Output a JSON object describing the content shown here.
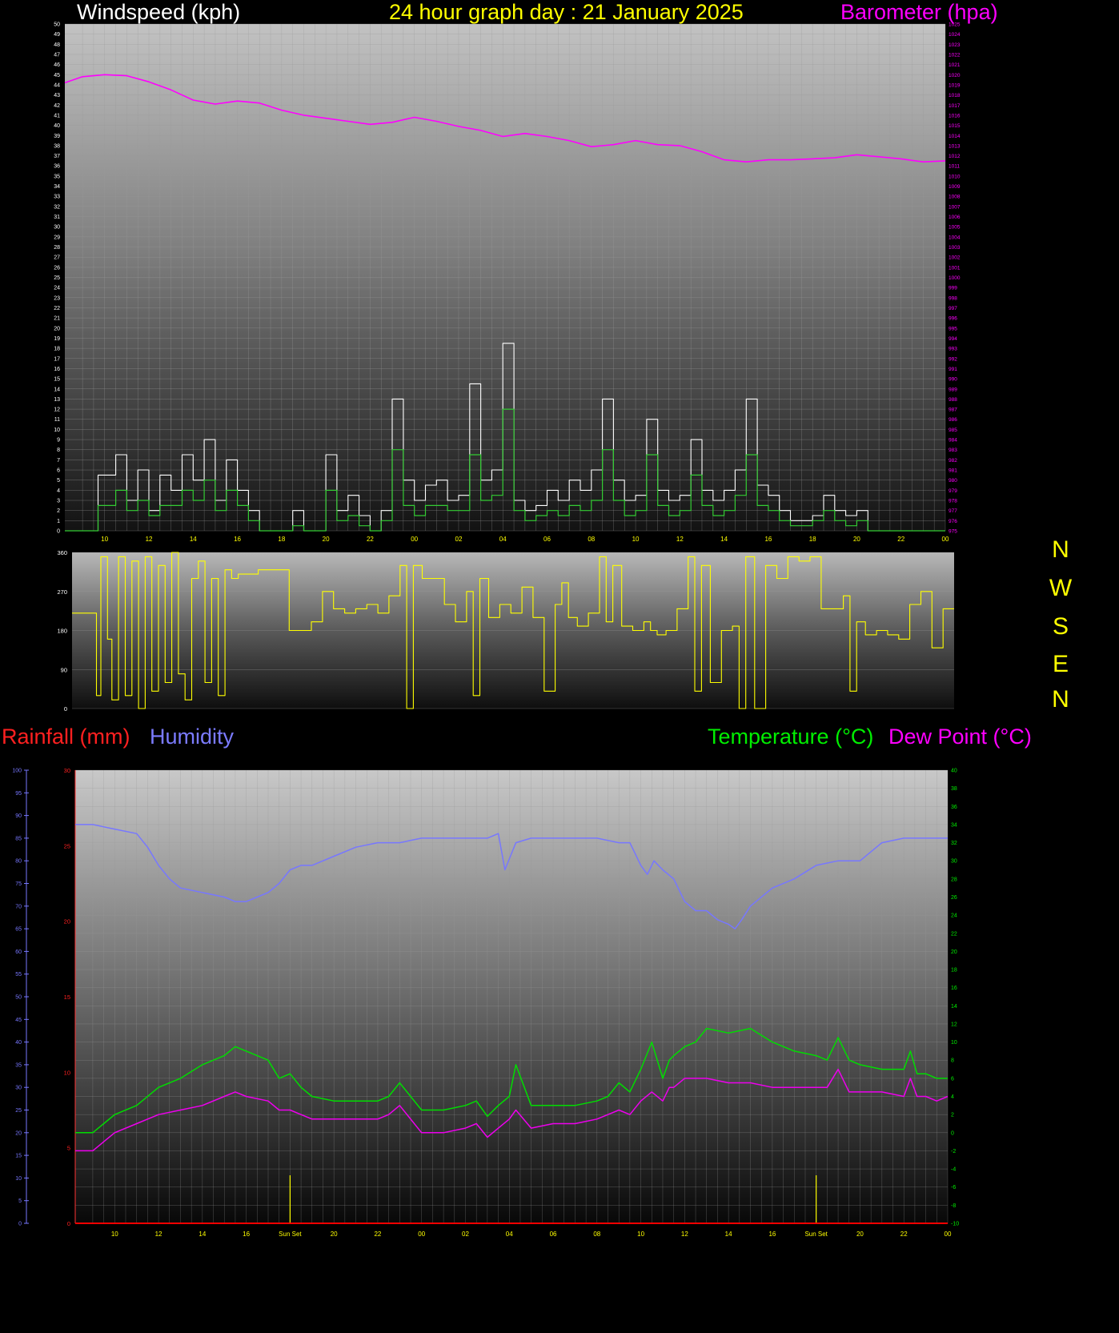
{
  "headers": {
    "wind_title": "Windspeed (kph)",
    "day_title": "24 hour graph day : 21 January 2025",
    "baro_title": "Barometer (hpa)",
    "rain_title": "Rainfall (mm)",
    "hum_title": "Humidity",
    "temp_title": "Temperature (°C)",
    "dew_title": "Dew Point (°C)"
  },
  "direction_labels": [
    "N",
    "W",
    "S",
    "E",
    "N"
  ],
  "colors": {
    "windspeed": "#ffffff",
    "wind_avg": "#33cc33",
    "barometer": "#ff00ff",
    "direction": "#ffff00",
    "temperature": "#00dd00",
    "dewpoint": "#ee00ee",
    "humidity": "#7777ff",
    "rainfall": "#ff0000",
    "title": "#ffff00"
  },
  "chart_data": [
    {
      "type": "line",
      "x_tick_labels": [
        "10",
        "12",
        "14",
        "16",
        "18",
        "20",
        "22",
        "00",
        "02",
        "04",
        "06",
        "08",
        "10",
        "12",
        "14",
        "16",
        "18",
        "20",
        "22",
        "00"
      ],
      "x_tick_hours": [
        10,
        12,
        14,
        16,
        18,
        20,
        22,
        24,
        26,
        28,
        30,
        32,
        34,
        36,
        38,
        40,
        42,
        44,
        46,
        48
      ],
      "x_range_hours": [
        8.2,
        48
      ],
      "left_axis": {
        "label": "Windspeed (kph)",
        "range": [
          0,
          50
        ]
      },
      "right_axis": {
        "label": "Barometer (hpa)",
        "range": [
          975,
          1025
        ]
      },
      "series": [
        {
          "name": "Barometer (hpa)",
          "axis": "right",
          "x": [
            8.2,
            9,
            10,
            11,
            12,
            13,
            14,
            15,
            16,
            17,
            18,
            19,
            20,
            21,
            22,
            23,
            24,
            25,
            26,
            27,
            28,
            29,
            30,
            31,
            32,
            33,
            34,
            35,
            36,
            37,
            38,
            39,
            40,
            41,
            42,
            43,
            44,
            45,
            46,
            47,
            48
          ],
          "y": [
            1019.2,
            1019.8,
            1020,
            1019.9,
            1019.3,
            1018.5,
            1017.5,
            1017.1,
            1017.4,
            1017.2,
            1016.5,
            1016,
            1015.7,
            1015.4,
            1015.1,
            1015.3,
            1015.8,
            1015.4,
            1014.9,
            1014.5,
            1013.9,
            1014.2,
            1013.9,
            1013.5,
            1012.9,
            1013.1,
            1013.5,
            1013.1,
            1013,
            1012.4,
            1011.6,
            1011.4,
            1011.6,
            1011.6,
            1011.7,
            1011.8,
            1012.1,
            1011.9,
            1011.7,
            1011.4,
            1011.5
          ]
        },
        {
          "name": "Windspeed (kph)",
          "axis": "left",
          "x": [
            8.2,
            9.5,
            9.7,
            10.5,
            11,
            11.5,
            12,
            12.5,
            13,
            13.5,
            14,
            14.5,
            15,
            15.5,
            16,
            16.5,
            17,
            17.5,
            18,
            18.5,
            19,
            19.5,
            20,
            20.5,
            21,
            21.5,
            22,
            22.5,
            23,
            23.5,
            24,
            24.5,
            25,
            25.5,
            26,
            26.5,
            27,
            27.5,
            28,
            28.5,
            29,
            29.5,
            30,
            30.5,
            31,
            31.5,
            32,
            32.5,
            33,
            33.5,
            34,
            34.5,
            35,
            35.5,
            36,
            36.5,
            37,
            37.5,
            38,
            38.5,
            39,
            39.5,
            40,
            40.5,
            41,
            41.5,
            42,
            42.5,
            43,
            43.5,
            44,
            44.5,
            45,
            45.5,
            46,
            46.5,
            47,
            47.5,
            48
          ],
          "y": [
            0,
            0,
            5.5,
            7.5,
            3,
            6,
            2,
            5.5,
            4,
            7.5,
            5,
            9,
            3,
            7,
            4,
            2,
            0,
            0,
            0,
            2,
            0,
            0,
            7.5,
            2,
            3.5,
            1.5,
            0,
            2,
            13,
            5,
            3,
            4.5,
            5,
            3,
            3.5,
            14.5,
            5,
            6,
            18.5,
            3,
            2,
            2.5,
            4,
            3,
            5,
            4,
            6,
            13,
            5,
            3,
            3.5,
            11,
            4,
            3,
            3.5,
            9,
            4,
            3,
            4,
            6,
            13,
            4.5,
            3.5,
            2,
            1,
            1,
            1.5,
            3.5,
            2,
            1.5,
            2,
            0,
            0,
            0,
            0,
            0,
            0,
            0,
            0
          ]
        },
        {
          "name": "Wind average",
          "axis": "left",
          "x": [
            8.2,
            9.5,
            9.7,
            10.5,
            11,
            11.5,
            12,
            12.5,
            13,
            13.5,
            14,
            14.5,
            15,
            15.5,
            16,
            16.5,
            17,
            17.5,
            18,
            18.5,
            19,
            19.5,
            20,
            20.5,
            21,
            21.5,
            22,
            22.5,
            23,
            23.5,
            24,
            24.5,
            25,
            25.5,
            26,
            26.5,
            27,
            27.5,
            28,
            28.5,
            29,
            29.5,
            30,
            30.5,
            31,
            31.5,
            32,
            32.5,
            33,
            33.5,
            34,
            34.5,
            35,
            35.5,
            36,
            36.5,
            37,
            37.5,
            38,
            38.5,
            39,
            39.5,
            40,
            40.5,
            41,
            41.5,
            42,
            42.5,
            43,
            43.5,
            44,
            44.5,
            45,
            45.5,
            46,
            46.5,
            47,
            47.5,
            48
          ],
          "y": [
            0,
            0,
            2.5,
            4,
            2,
            3,
            1.5,
            2.5,
            2.5,
            4,
            3,
            5,
            2,
            4,
            2.5,
            1,
            0,
            0,
            0,
            0.5,
            0,
            0,
            4,
            1,
            1.5,
            0.5,
            0,
            1,
            8,
            2.5,
            1.5,
            2.5,
            2.5,
            2,
            2,
            7.5,
            3,
            3.5,
            12,
            2,
            1,
            1.5,
            2,
            1.5,
            2.5,
            2,
            3,
            8,
            3,
            1.5,
            2,
            7.5,
            2.5,
            1.5,
            2,
            5.5,
            2.5,
            1.5,
            2,
            3.5,
            7.5,
            2.5,
            2,
            1,
            0.5,
            0.5,
            1,
            2,
            1,
            0.5,
            1,
            0,
            0,
            0,
            0,
            0,
            0,
            0,
            0
          ]
        }
      ]
    },
    {
      "type": "line",
      "y_tick_labels": [
        "360",
        "270",
        "180",
        "90",
        "0"
      ],
      "y_range": [
        0,
        360
      ],
      "x_range_hours": [
        8.2,
        48
      ],
      "series": [
        {
          "name": "Wind direction",
          "axis": "left",
          "x": [
            8.2,
            9,
            9.3,
            9.5,
            9.8,
            10,
            10.3,
            10.6,
            10.9,
            11.2,
            11.5,
            11.8,
            12.1,
            12.4,
            12.7,
            13,
            13.3,
            13.6,
            13.9,
            14.2,
            14.5,
            14.8,
            15.1,
            15.4,
            15.7,
            16,
            16.3,
            16.6,
            17,
            17.5,
            18,
            18.5,
            19,
            19.5,
            20,
            20.5,
            21,
            21.5,
            22,
            22.5,
            23,
            23.3,
            23.6,
            24,
            24.5,
            25,
            25.5,
            26,
            26.3,
            26.6,
            27,
            27.5,
            28,
            28.5,
            29,
            29.5,
            30,
            30.3,
            30.6,
            31,
            31.5,
            32,
            32.3,
            32.6,
            33,
            33.5,
            34,
            34.3,
            34.6,
            35,
            35.5,
            36,
            36.3,
            36.6,
            37,
            37.5,
            38,
            38.3,
            38.6,
            39,
            39.5,
            40,
            40.5,
            41,
            41.5,
            42,
            42.5,
            43,
            43.3,
            43.6,
            44,
            44.5,
            45,
            45.5,
            46,
            46.5,
            47,
            47.5,
            48
          ],
          "y": [
            220,
            220,
            30,
            350,
            160,
            20,
            350,
            30,
            340,
            0,
            350,
            40,
            330,
            60,
            360,
            80,
            20,
            300,
            340,
            60,
            300,
            30,
            320,
            300,
            310,
            310,
            310,
            320,
            320,
            320,
            180,
            180,
            200,
            270,
            230,
            220,
            230,
            240,
            220,
            260,
            330,
            0,
            330,
            300,
            300,
            240,
            200,
            270,
            30,
            300,
            210,
            240,
            220,
            280,
            210,
            40,
            240,
            290,
            210,
            190,
            220,
            350,
            200,
            330,
            190,
            180,
            200,
            180,
            170,
            180,
            230,
            350,
            40,
            330,
            60,
            180,
            190,
            0,
            350,
            0,
            330,
            300,
            350,
            340,
            350,
            230,
            230,
            260,
            40,
            200,
            170,
            180,
            170,
            160,
            240,
            270,
            140,
            230,
            230
          ]
        }
      ]
    },
    {
      "type": "line",
      "x_tick_labels": [
        "10",
        "12",
        "14",
        "16",
        "Sun Set",
        "20",
        "22",
        "00",
        "02",
        "04",
        "06",
        "08",
        "10",
        "12",
        "14",
        "16",
        "Sun Set",
        "20",
        "22",
        "00"
      ],
      "x_tick_hours": [
        10,
        12,
        14,
        16,
        18,
        20,
        22,
        24,
        26,
        28,
        30,
        32,
        34,
        36,
        38,
        40,
        42,
        44,
        46,
        48
      ],
      "x_range_hours": [
        8.2,
        48
      ],
      "rain_axis": {
        "label": "Rainfall (mm)",
        "range": [
          0,
          30
        ]
      },
      "humidity_axis": {
        "label": "Humidity",
        "range": [
          0,
          100
        ]
      },
      "temp_axis": {
        "label": "Temperature (°C)",
        "range": [
          -10,
          40
        ]
      },
      "series": [
        {
          "name": "Humidity",
          "axis": "humidity",
          "x": [
            8.2,
            9,
            10,
            11,
            11.5,
            12,
            12.5,
            13,
            14,
            15,
            15.5,
            16,
            16.5,
            17,
            17.5,
            18,
            18.5,
            19,
            20,
            21,
            22,
            23,
            24,
            25,
            26,
            27,
            27.5,
            27.8,
            28.3,
            29,
            30,
            31,
            32,
            33,
            33.5,
            34,
            34.3,
            34.6,
            35,
            35.5,
            36,
            36.5,
            37,
            37.5,
            38,
            38.3,
            38.6,
            39,
            40,
            41,
            42,
            43,
            44,
            45,
            46,
            47,
            48
          ],
          "y": [
            88,
            88,
            87,
            86,
            83,
            79,
            76,
            74,
            73,
            72,
            71,
            71,
            72,
            73,
            75,
            78,
            79,
            79,
            81,
            83,
            84,
            84,
            85,
            85,
            85,
            85,
            86,
            78,
            84,
            85,
            85,
            85,
            85,
            84,
            84,
            79,
            77,
            80,
            78,
            76,
            71,
            69,
            69,
            67,
            66,
            65,
            67,
            70,
            74,
            76,
            79,
            80,
            80,
            84,
            85,
            85,
            85
          ]
        },
        {
          "name": "Temperature (°C)",
          "axis": "temp",
          "x": [
            8.2,
            9,
            9.5,
            10,
            11,
            12,
            13,
            14,
            15,
            15.5,
            16,
            17,
            17.5,
            18,
            18.5,
            19,
            20,
            21,
            22,
            22.5,
            23,
            24,
            25,
            26,
            26.5,
            27,
            27.5,
            28,
            28.3,
            29,
            30,
            31,
            32,
            32.5,
            33,
            33.5,
            34,
            34.5,
            35,
            35.3,
            35.5,
            36,
            36.5,
            37,
            38,
            39,
            40,
            41,
            42,
            42.5,
            43,
            43.5,
            44,
            45,
            46,
            46.3,
            46.6,
            47,
            47.5,
            48
          ],
          "y": [
            0,
            0,
            1,
            2,
            3,
            5,
            6,
            7.5,
            8.5,
            9.5,
            9,
            8,
            6,
            6.5,
            5,
            4,
            3.5,
            3.5,
            3.5,
            4,
            5.5,
            2.5,
            2.5,
            3,
            3.5,
            1.8,
            3,
            4,
            7.5,
            3,
            3,
            3,
            3.5,
            4,
            5.5,
            4.5,
            7,
            10,
            6,
            8,
            8.5,
            9.5,
            10,
            11.5,
            11,
            11.5,
            10,
            9,
            8.5,
            8,
            10.5,
            8,
            7.5,
            7,
            7,
            9,
            6.5,
            6.5,
            6,
            6
          ]
        },
        {
          "name": "Dew Point (°C)",
          "axis": "temp",
          "x": [
            8.2,
            9,
            9.5,
            10,
            11,
            12,
            13,
            14,
            15,
            15.5,
            16,
            17,
            17.5,
            18,
            18.5,
            19,
            20,
            21,
            22,
            22.5,
            23,
            24,
            25,
            26,
            26.5,
            27,
            27.5,
            28,
            28.3,
            29,
            30,
            31,
            32,
            32.5,
            33,
            33.5,
            34,
            34.5,
            35,
            35.3,
            35.5,
            36,
            36.5,
            37,
            38,
            39,
            40,
            41,
            42,
            42.5,
            43,
            43.5,
            44,
            45,
            46,
            46.3,
            46.6,
            47,
            47.5,
            48
          ],
          "y": [
            -2,
            -2,
            -1,
            0,
            1,
            2,
            2.5,
            3,
            4,
            4.5,
            4,
            3.5,
            2.5,
            2.5,
            2,
            1.5,
            1.5,
            1.5,
            1.5,
            2,
            3,
            0,
            0,
            0.5,
            1,
            -0.5,
            0.5,
            1.5,
            2.5,
            0.5,
            1,
            1,
            1.5,
            2,
            2.5,
            2,
            3.5,
            4.5,
            3.5,
            5,
            5,
            6,
            6,
            6,
            5.5,
            5.5,
            5,
            5,
            5,
            5,
            7,
            4.5,
            4.5,
            4.5,
            4,
            6,
            4,
            4,
            3.5,
            4
          ]
        },
        {
          "name": "Rainfall (mm)",
          "axis": "rain",
          "x": [
            8.2,
            48
          ],
          "y": [
            0,
            0
          ]
        }
      ]
    }
  ]
}
